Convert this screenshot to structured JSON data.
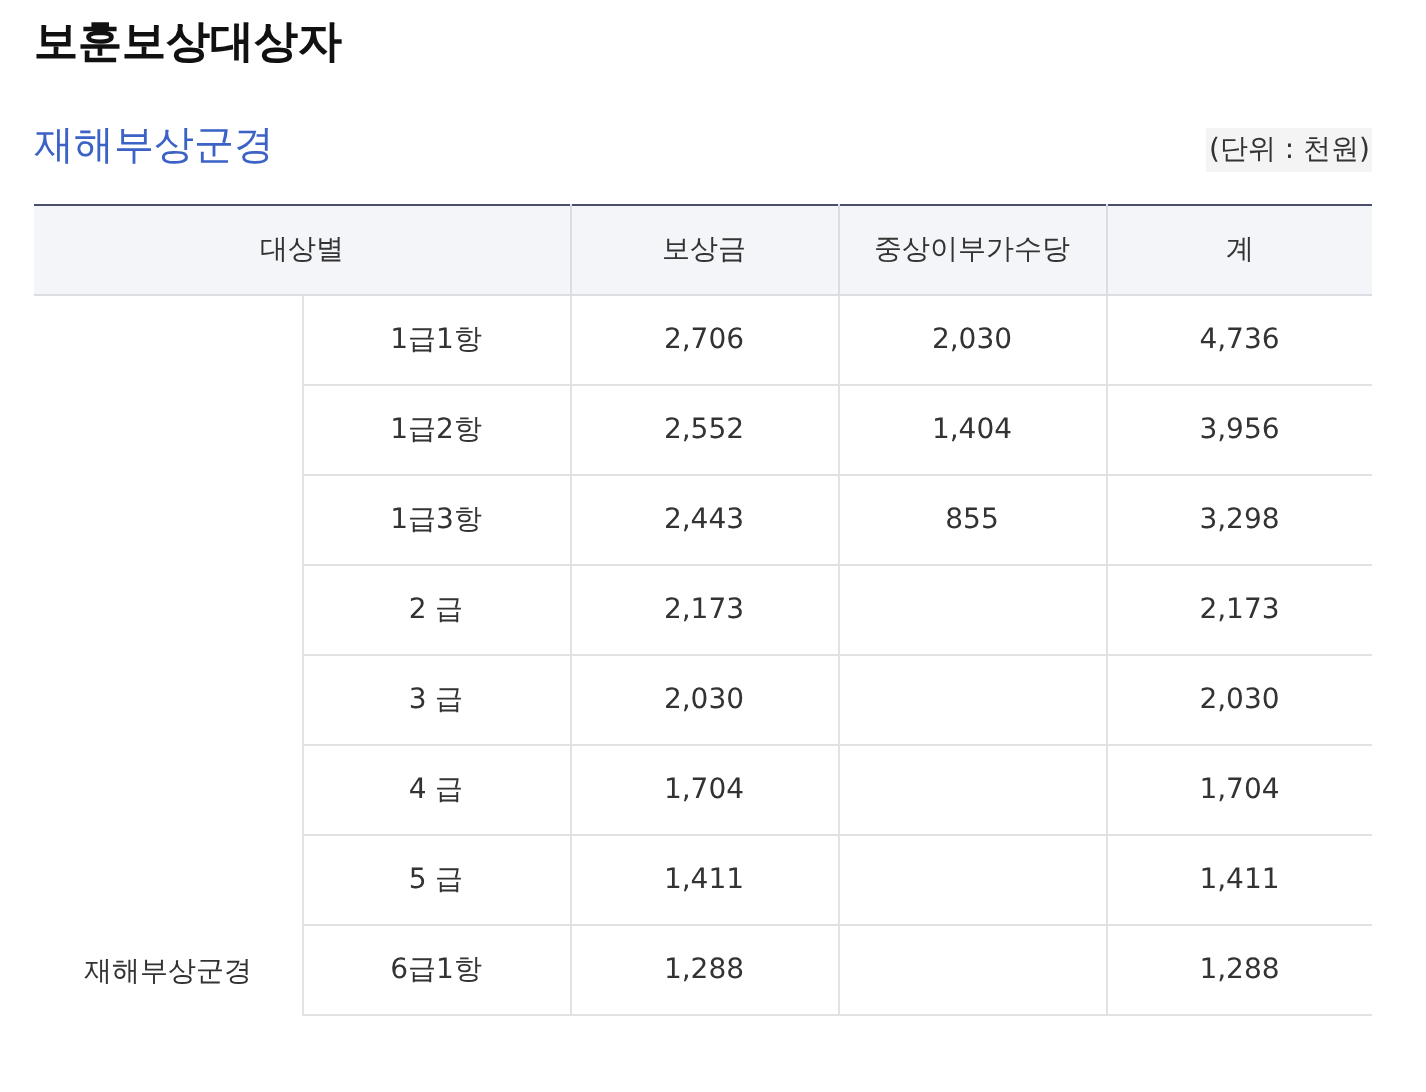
{
  "page_title": "보훈보상대상자",
  "section": {
    "title": "재해부상군경",
    "unit_note": "(단위 : 천원)"
  },
  "table": {
    "columns": [
      "대상별",
      "보상금",
      "중상이부가수당",
      "계"
    ],
    "group": {
      "label": "재해부상군경",
      "rows": [
        {
          "grade": "1급1항",
          "compensation": "2,706",
          "allowance": "2,030",
          "total": "4,736"
        },
        {
          "grade": "1급2항",
          "compensation": "2,552",
          "allowance": "1,404",
          "total": "3,956"
        },
        {
          "grade": "1급3항",
          "compensation": "2,443",
          "allowance": "855",
          "total": "3,298"
        },
        {
          "grade": "2 급",
          "compensation": "2,173",
          "total": "2,173"
        },
        {
          "grade": "3 급",
          "compensation": "2,030",
          "total": "2,030"
        },
        {
          "grade": "4 급",
          "compensation": "1,704",
          "total": "1,704"
        },
        {
          "grade": "5 급",
          "compensation": "1,411",
          "total": "1,411"
        },
        {
          "grade": "6급1항",
          "compensation": "1,288",
          "total": "1,288"
        }
      ]
    }
  }
}
